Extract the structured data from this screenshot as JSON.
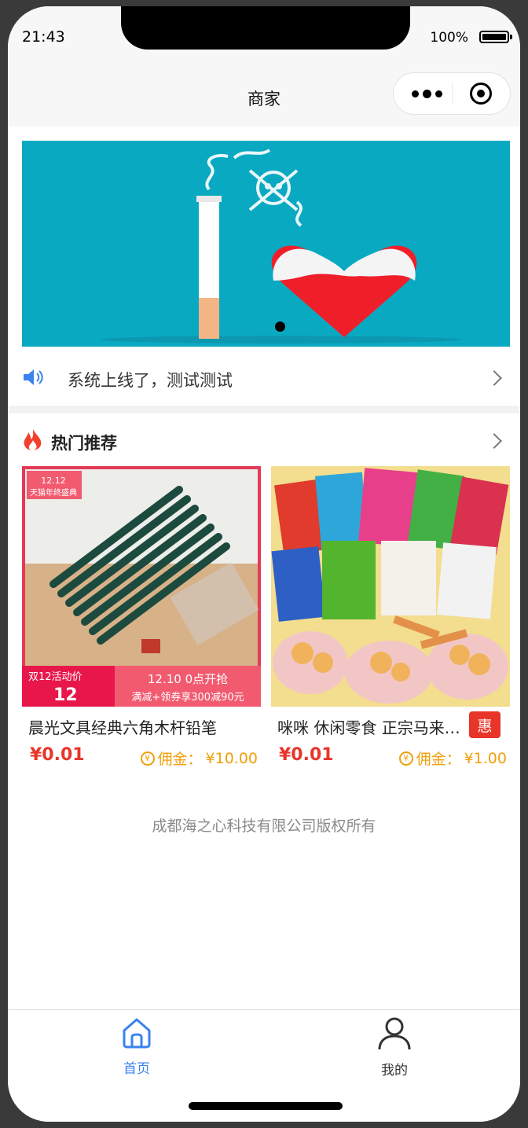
{
  "status_bar": {
    "time": "21:43",
    "battery": "100%"
  },
  "nav": {
    "title": "商家"
  },
  "notice": {
    "text": "系统上线了，测试测试"
  },
  "section": {
    "title": "热门推荐"
  },
  "products": [
    {
      "name": "晨光文具经典六角木杆铅笔",
      "price": "¥0.01",
      "commission_label": "佣金：",
      "commission_value": "¥10.00",
      "image_text": {
        "badge_top": "12.12",
        "badge_sub": "天猫年终盛典",
        "promo_left_title": "双12活动价",
        "promo_left_num": "12",
        "promo_right_line1": "12.10 0点开抢",
        "promo_right_line2": "满减+领券享300减90元"
      }
    },
    {
      "name": "咪咪 休闲零食 正宗马来西亚",
      "price": "¥0.01",
      "commission_label": "佣金：",
      "commission_value": "¥1.00",
      "badge": "惠"
    }
  ],
  "footer": {
    "copyright": "成都海之心科技有限公司版权所有"
  },
  "tabbar": {
    "home": "首页",
    "mine": "我的"
  },
  "colors": {
    "accent": "#3a82f0",
    "price": "#e8352a",
    "commission": "#f0a00b",
    "banner_bg": "#0aa9c2"
  }
}
